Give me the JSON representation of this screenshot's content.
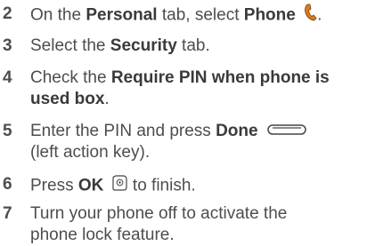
{
  "steps": [
    {
      "num": "2",
      "parts": [
        "On the ",
        "Personal",
        " tab, select ",
        "Phone",
        "."
      ],
      "icon": "phone-handset-icon"
    },
    {
      "num": "3",
      "parts": [
        "Select the ",
        "Security",
        " tab."
      ]
    },
    {
      "num": "4",
      "lines": [
        [
          "Check the ",
          "Require PIN when phone is"
        ],
        [
          "used box",
          "."
        ]
      ]
    },
    {
      "num": "5",
      "lines": [
        [
          "Enter the PIN and press ",
          "Done"
        ],
        [
          "(left action key)."
        ]
      ],
      "icon": "left-action-key-icon"
    },
    {
      "num": "6",
      "parts": [
        "Press ",
        "OK",
        " to finish."
      ],
      "icon": "ok-button-icon"
    },
    {
      "num": "7",
      "lines": [
        "Turn your phone off to activate the",
        "phone lock feature."
      ]
    }
  ],
  "colors": {
    "text": "#4d4d4d",
    "bold": "#3a3a3a",
    "phone_icon": "#e07b1a"
  }
}
